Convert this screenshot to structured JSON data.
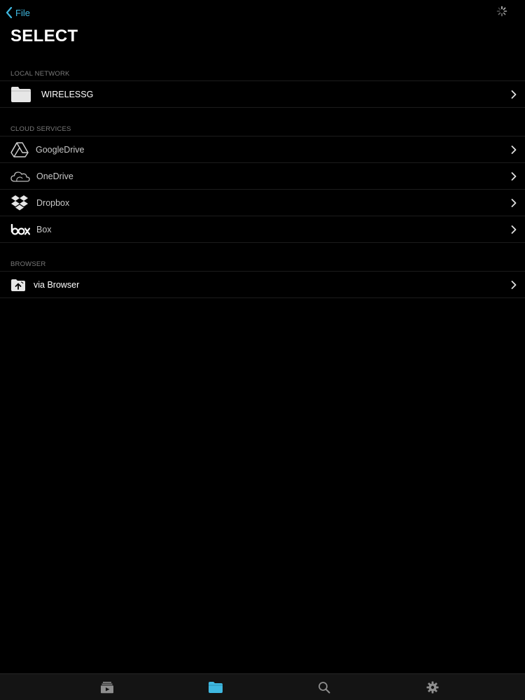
{
  "nav": {
    "back_label": "File"
  },
  "page": {
    "title": "SELECT"
  },
  "sections": {
    "local": {
      "header": "LOCAL NETWORK",
      "items": [
        {
          "label": "WIRELESSG",
          "icon": "folder-icon"
        }
      ]
    },
    "cloud": {
      "header": "CLOUD SERVICES",
      "items": [
        {
          "label": "GoogleDrive",
          "icon": "google-drive-icon"
        },
        {
          "label": "OneDrive",
          "icon": "onedrive-icon"
        },
        {
          "label": "Dropbox",
          "icon": "dropbox-icon"
        },
        {
          "label": "Box",
          "icon": "box-icon"
        }
      ]
    },
    "browser": {
      "header": "BROWSER",
      "items": [
        {
          "label": "via Browser",
          "icon": "browser-upload-icon"
        }
      ]
    }
  },
  "tab_bar": {
    "tabs": [
      {
        "icon": "media-library-icon",
        "active": false
      },
      {
        "icon": "folder-icon",
        "active": true
      },
      {
        "icon": "search-icon",
        "active": false
      },
      {
        "icon": "gear-icon",
        "active": false
      }
    ]
  },
  "colors": {
    "accent": "#3fb8e0",
    "background": "#000000",
    "tab_bar_background": "#141414",
    "separator": "#1c1c1c",
    "section_header": "#7a7a7a",
    "inactive_icon": "#8e8e8e"
  }
}
